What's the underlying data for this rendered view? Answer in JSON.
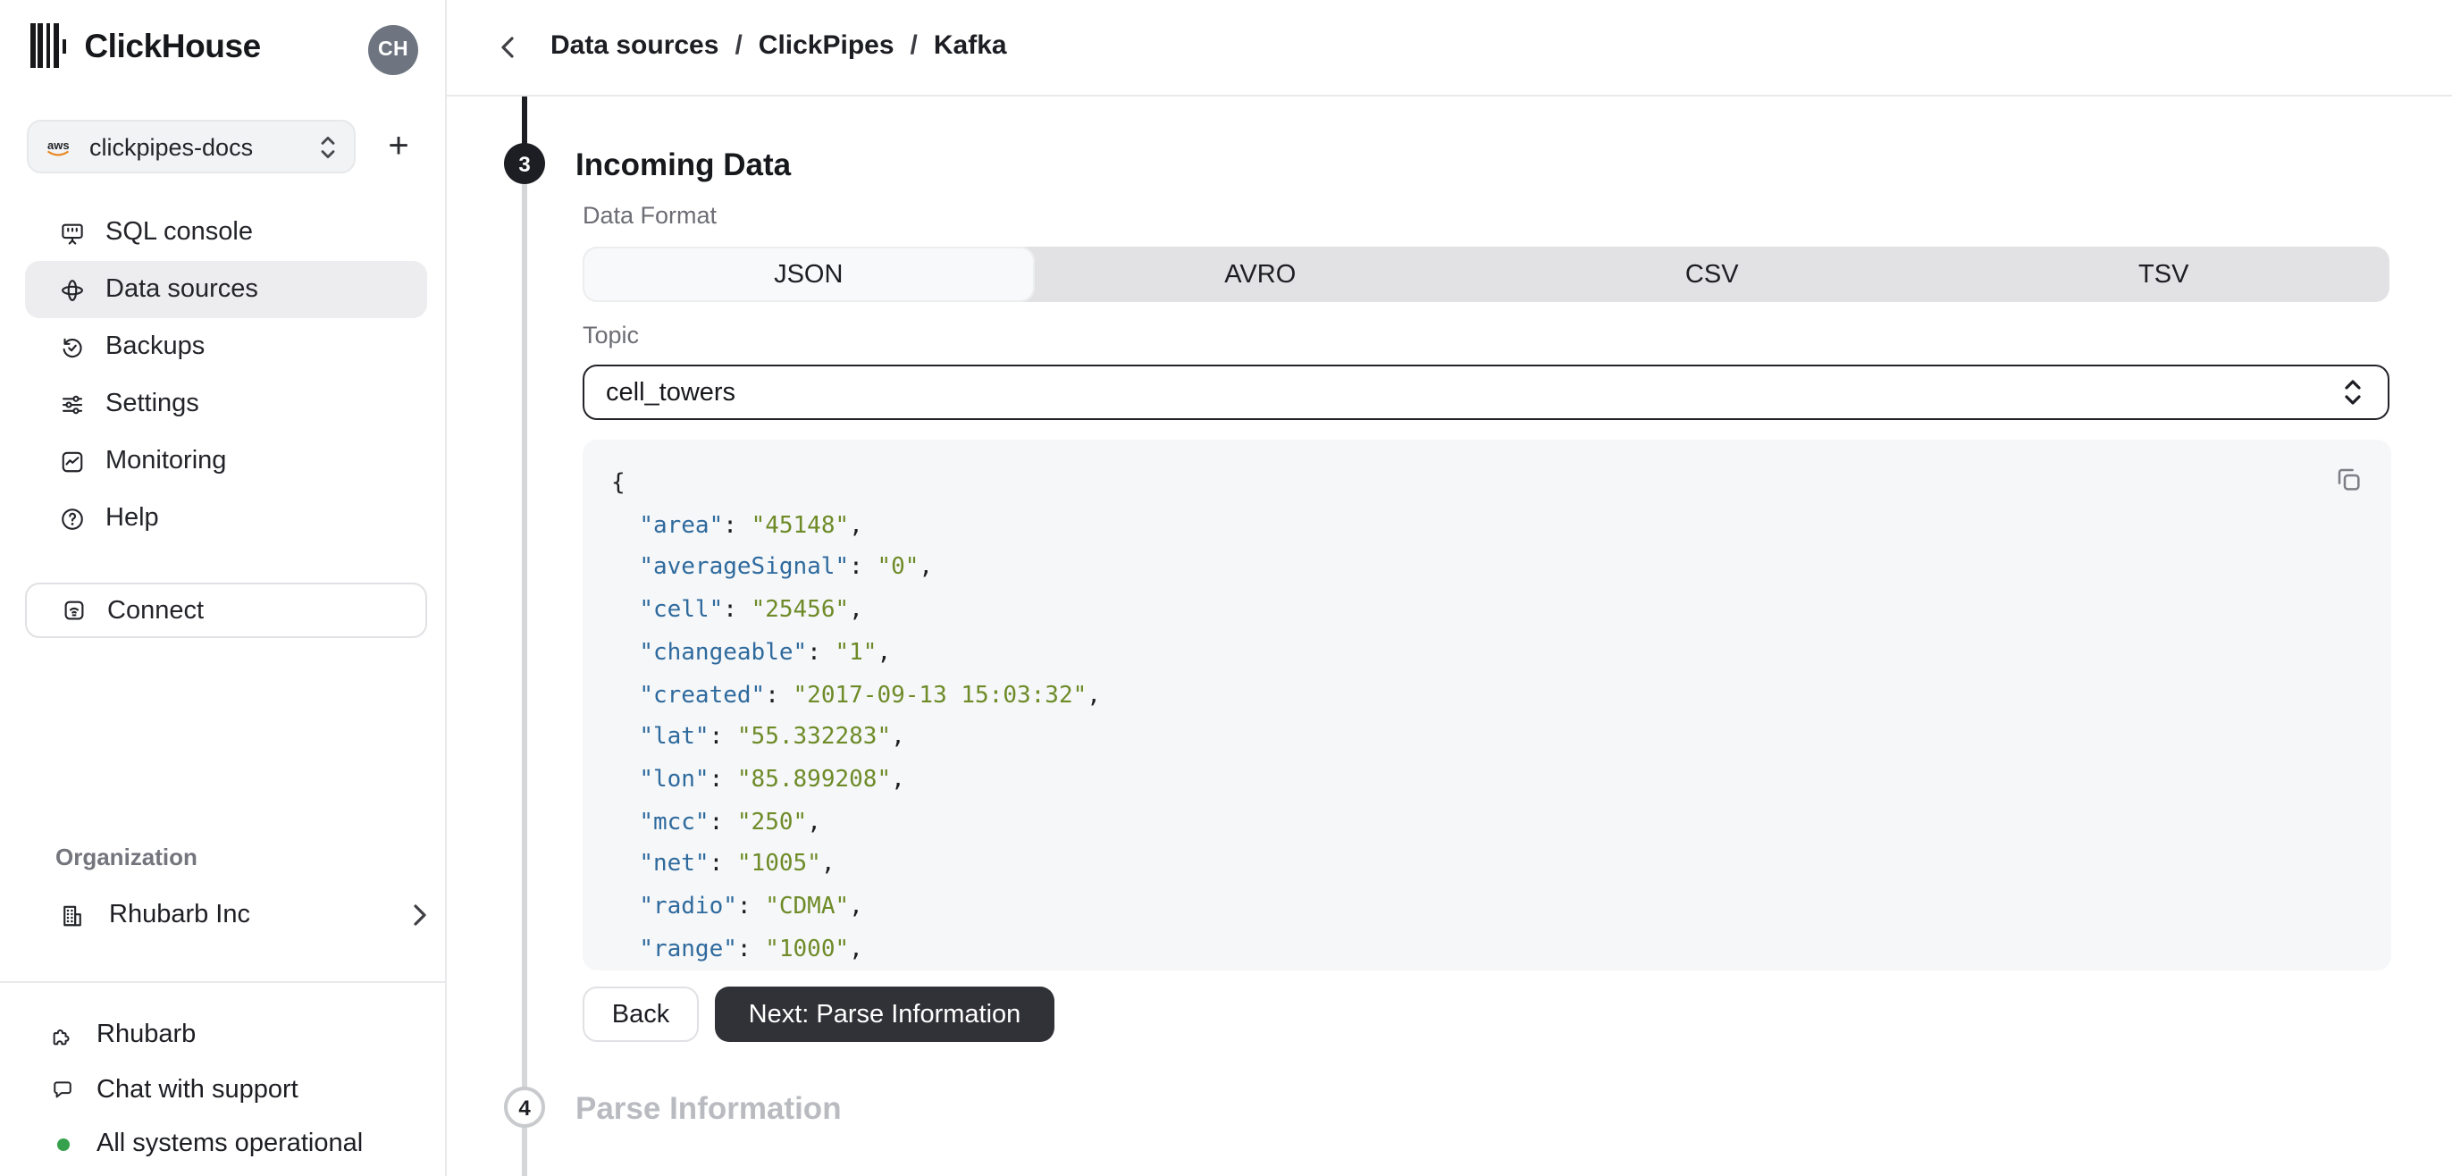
{
  "sidebar": {
    "app_title": "ClickHouse",
    "avatar_initials": "CH",
    "service_selector": {
      "value": "clickpipes-docs",
      "provider": "aws"
    },
    "nav_items": [
      {
        "icon": "sql-console-icon",
        "label": "SQL console",
        "selected": false
      },
      {
        "icon": "data-sources-icon",
        "label": "Data sources",
        "selected": true
      },
      {
        "icon": "backups-icon",
        "label": "Backups",
        "selected": false
      },
      {
        "icon": "settings-icon",
        "label": "Settings",
        "selected": false
      },
      {
        "icon": "monitoring-icon",
        "label": "Monitoring",
        "selected": false
      },
      {
        "icon": "help-icon",
        "label": "Help",
        "selected": false
      }
    ],
    "connect_label": "Connect",
    "org_section_label": "Organization",
    "org_name": "Rhubarb Inc",
    "footer_items": [
      {
        "icon": "puzzle-icon",
        "label": "Rhubarb"
      },
      {
        "icon": "chat-icon",
        "label": "Chat with support"
      },
      {
        "icon": "status-dot",
        "label": "All systems operational",
        "dot_color": "#36a14d"
      }
    ]
  },
  "breadcrumb": {
    "items": [
      "Data sources",
      "ClickPipes",
      "Kafka"
    ],
    "separator": "/"
  },
  "steps": {
    "current": {
      "number": "3",
      "title": "Incoming Data"
    },
    "next": {
      "number": "4",
      "title": "Parse Information"
    }
  },
  "form": {
    "data_format_label": "Data Format",
    "format_options": [
      "JSON",
      "AVRO",
      "CSV",
      "TSV"
    ],
    "format_selected": "JSON",
    "topic_label": "Topic",
    "topic_value": "cell_towers"
  },
  "code_preview": {
    "lines": [
      [
        {
          "t": "p",
          "s": "{"
        }
      ],
      [
        {
          "t": "p",
          "s": "  "
        },
        {
          "t": "k",
          "s": "\"area\""
        },
        {
          "t": "p",
          "s": ": "
        },
        {
          "t": "v",
          "s": "\"45148\""
        },
        {
          "t": "p",
          "s": ","
        }
      ],
      [
        {
          "t": "p",
          "s": "  "
        },
        {
          "t": "k",
          "s": "\"averageSignal\""
        },
        {
          "t": "p",
          "s": ": "
        },
        {
          "t": "v",
          "s": "\"0\""
        },
        {
          "t": "p",
          "s": ","
        }
      ],
      [
        {
          "t": "p",
          "s": "  "
        },
        {
          "t": "k",
          "s": "\"cell\""
        },
        {
          "t": "p",
          "s": ": "
        },
        {
          "t": "v",
          "s": "\"25456\""
        },
        {
          "t": "p",
          "s": ","
        }
      ],
      [
        {
          "t": "p",
          "s": "  "
        },
        {
          "t": "k",
          "s": "\"changeable\""
        },
        {
          "t": "p",
          "s": ": "
        },
        {
          "t": "v",
          "s": "\"1\""
        },
        {
          "t": "p",
          "s": ","
        }
      ],
      [
        {
          "t": "p",
          "s": "  "
        },
        {
          "t": "k",
          "s": "\"created\""
        },
        {
          "t": "p",
          "s": ": "
        },
        {
          "t": "v",
          "s": "\"2017-09-13 15:03:32\""
        },
        {
          "t": "p",
          "s": ","
        }
      ],
      [
        {
          "t": "p",
          "s": "  "
        },
        {
          "t": "k",
          "s": "\"lat\""
        },
        {
          "t": "p",
          "s": ": "
        },
        {
          "t": "v",
          "s": "\"55.332283\""
        },
        {
          "t": "p",
          "s": ","
        }
      ],
      [
        {
          "t": "p",
          "s": "  "
        },
        {
          "t": "k",
          "s": "\"lon\""
        },
        {
          "t": "p",
          "s": ": "
        },
        {
          "t": "v",
          "s": "\"85.899208\""
        },
        {
          "t": "p",
          "s": ","
        }
      ],
      [
        {
          "t": "p",
          "s": "  "
        },
        {
          "t": "k",
          "s": "\"mcc\""
        },
        {
          "t": "p",
          "s": ": "
        },
        {
          "t": "v",
          "s": "\"250\""
        },
        {
          "t": "p",
          "s": ","
        }
      ],
      [
        {
          "t": "p",
          "s": "  "
        },
        {
          "t": "k",
          "s": "\"net\""
        },
        {
          "t": "p",
          "s": ": "
        },
        {
          "t": "v",
          "s": "\"1005\""
        },
        {
          "t": "p",
          "s": ","
        }
      ],
      [
        {
          "t": "p",
          "s": "  "
        },
        {
          "t": "k",
          "s": "\"radio\""
        },
        {
          "t": "p",
          "s": ": "
        },
        {
          "t": "v",
          "s": "\"CDMA\""
        },
        {
          "t": "p",
          "s": ","
        }
      ],
      [
        {
          "t": "p",
          "s": "  "
        },
        {
          "t": "k",
          "s": "\"range\""
        },
        {
          "t": "p",
          "s": ": "
        },
        {
          "t": "v",
          "s": "\"1000\""
        },
        {
          "t": "p",
          "s": ","
        }
      ]
    ]
  },
  "actions": {
    "back": "Back",
    "next": "Next: Parse Information"
  },
  "colors": {
    "key": "#2e6a9d",
    "value": "#6e8b28",
    "status_ok": "#36a14d",
    "step_current": "#1d1e23",
    "accent_dark_button": "#313138",
    "code_bg": "#f6f7f9"
  }
}
